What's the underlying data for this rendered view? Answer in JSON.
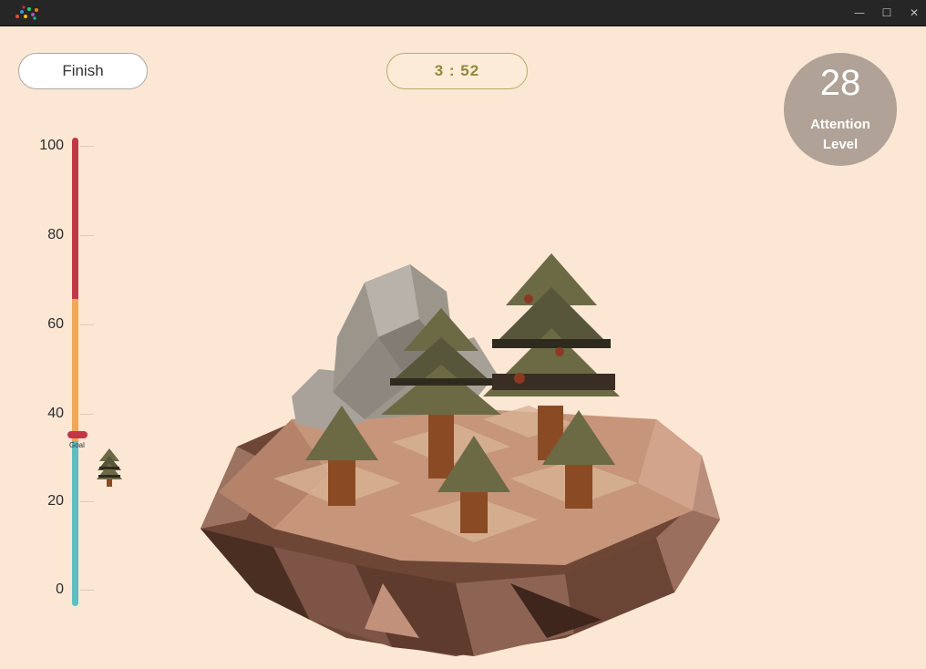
{
  "window": {
    "minimize_glyph": "—",
    "maximize_glyph": "☐",
    "close_glyph": "✕"
  },
  "finish_button": {
    "label": "Finish"
  },
  "timer": {
    "value": "3 : 52"
  },
  "attention": {
    "value": "28",
    "label_line1": "Attention",
    "label_line2": "Level"
  },
  "gauge": {
    "ticks": [
      "100",
      "80",
      "60",
      "40",
      "20",
      "0"
    ],
    "goal_label": "Goal",
    "goal_value": 35,
    "colors": {
      "high": "#c23748",
      "mid": "#eda85a",
      "low": "#5cbfc0"
    }
  },
  "scene": {
    "icons": [
      "app-logo-icon",
      "mini-tree-icon",
      "floating-island-with-trees"
    ],
    "colors": {
      "background": "#fbe7d4",
      "tree_foliage": "#6b6a45",
      "tree_trunk": "#8a4b24",
      "rock": "#9c958c",
      "ground_top": "#c79677",
      "cliff": "#7a5140"
    }
  }
}
